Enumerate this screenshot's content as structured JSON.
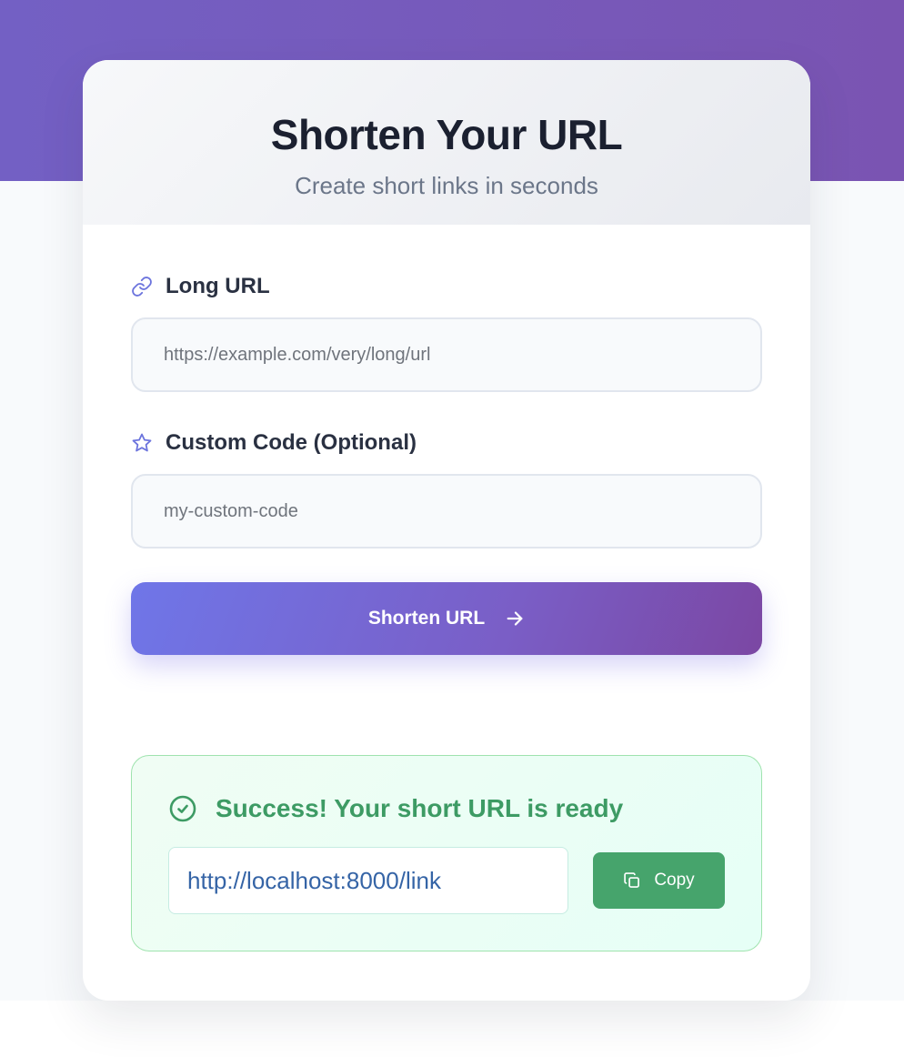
{
  "header": {
    "title": "Shorten Your URL",
    "subtitle": "Create short links in seconds"
  },
  "form": {
    "long_url": {
      "label": "Long URL",
      "icon": "link-icon",
      "value": "",
      "placeholder": "https://example.com/very/long/url"
    },
    "custom_code": {
      "label": "Custom Code (Optional)",
      "icon": "star-icon",
      "value": "",
      "placeholder": "my-custom-code"
    },
    "submit": {
      "label": "Shorten URL",
      "icon": "arrow-right-icon"
    }
  },
  "result": {
    "heading": "Success! Your short URL is ready",
    "icon": "check-circle-icon",
    "short_url": "http://localhost:8000/link",
    "copy_label": "Copy",
    "copy_icon": "copy-icon"
  },
  "colors": {
    "accent_start": "#6f76e8",
    "accent_end": "#7b47a3",
    "success": "#3d9b64",
    "copy_button": "#46a46c",
    "link_text": "#3564a6"
  }
}
